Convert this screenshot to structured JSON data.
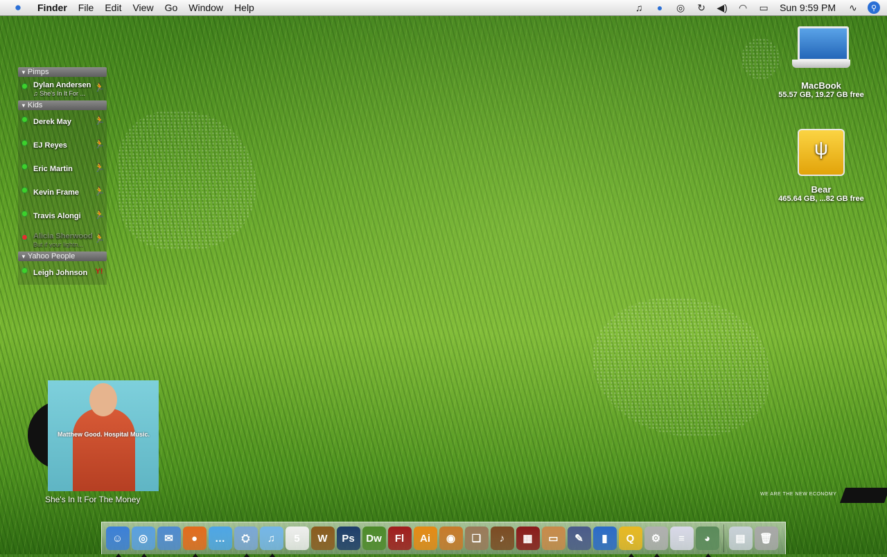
{
  "menubar": {
    "apple_icon": "apple-icon",
    "app_name": "Finder",
    "menus": [
      "File",
      "Edit",
      "View",
      "Go",
      "Window",
      "Help"
    ],
    "status_icons": [
      "music-note-icon",
      "adium-icon",
      "time-machine-icon",
      "sync-icon",
      "volume-icon",
      "wifi-icon",
      "battery-icon"
    ],
    "clock": "Sun 9:59 PM",
    "activity_icon": "activity-icon",
    "spotlight_icon": "spotlight-icon"
  },
  "buddy_list": {
    "groups": [
      {
        "name": "Pimps",
        "buddies": [
          {
            "name": "Dylan Andersen",
            "status": "♫ She's In It For ...",
            "online": true,
            "service": "aim"
          }
        ]
      },
      {
        "name": "Kids",
        "buddies": [
          {
            "name": "Derek May",
            "status": "",
            "online": true,
            "service": "aim"
          },
          {
            "name": "EJ Reyes",
            "status": "",
            "online": true,
            "service": "aim"
          },
          {
            "name": "Eric Martin",
            "status": "",
            "online": true,
            "service": "aim"
          },
          {
            "name": "Kevin Frame",
            "status": "",
            "online": true,
            "service": "aim"
          },
          {
            "name": "Travis Alongi",
            "status": "",
            "online": true,
            "service": "aim"
          },
          {
            "name": "Alicia Sherwood",
            "status": "But if your lightn...",
            "online": false,
            "service": "aim"
          }
        ]
      },
      {
        "name": "Yahoo People",
        "buddies": [
          {
            "name": "Leigh Johnson",
            "status": "",
            "online": true,
            "service": "yahoo"
          }
        ]
      }
    ]
  },
  "desktop": {
    "macbook": {
      "title": "MacBook",
      "sub": "55.57 GB, 19.27 GB free"
    },
    "bear": {
      "title": "Bear",
      "sub": "465.64 GB, ...82 GB free"
    }
  },
  "now_playing": {
    "cover_text": "Matthew Good. Hospital Music.",
    "track": "She's In It For The Money"
  },
  "watermark": "WE ARE THE NEW ECONOMY",
  "dock": {
    "apps": [
      {
        "name": "finder",
        "label": "☺",
        "color": "#3b7fd8",
        "running": true
      },
      {
        "name": "safari",
        "label": "◎",
        "color": "#5aa0e0",
        "running": true
      },
      {
        "name": "mail",
        "label": "✉",
        "color": "#4f8ad0",
        "running": false
      },
      {
        "name": "firefox",
        "label": "●",
        "color": "#e36b1c",
        "running": true
      },
      {
        "name": "ichat",
        "label": "…",
        "color": "#4da6e6",
        "running": false
      },
      {
        "name": "preview",
        "label": "⛭",
        "color": "#7ba7d6",
        "running": true
      },
      {
        "name": "itunes",
        "label": "♫",
        "color": "#74b6e8",
        "running": true
      },
      {
        "name": "ical",
        "label": "5",
        "color": "#eeeeee",
        "running": false
      },
      {
        "name": "warcraft",
        "label": "W",
        "color": "#8a5a1e",
        "running": false
      },
      {
        "name": "photoshop",
        "label": "Ps",
        "color": "#1d3c6a",
        "running": false
      },
      {
        "name": "dreamweaver",
        "label": "Dw",
        "color": "#4d8a2a",
        "running": false
      },
      {
        "name": "flash",
        "label": "Fl",
        "color": "#a01c1c",
        "running": false
      },
      {
        "name": "illustrator",
        "label": "Ai",
        "color": "#e58a14",
        "running": false
      },
      {
        "name": "image-capture",
        "label": "◉",
        "color": "#c87a2a",
        "running": false
      },
      {
        "name": "iphoto",
        "label": "❏",
        "color": "#9a7a5a",
        "running": false
      },
      {
        "name": "garageband",
        "label": "♪",
        "color": "#7b4a22",
        "running": false
      },
      {
        "name": "imovie",
        "label": "▦",
        "color": "#8a1a1a",
        "running": false
      },
      {
        "name": "frontrow",
        "label": "▭",
        "color": "#c88a4a",
        "running": false
      },
      {
        "name": "script-editor",
        "label": "✎",
        "color": "#4a5a8a",
        "running": false
      },
      {
        "name": "activity-monitor",
        "label": "▮",
        "color": "#2a6ac8",
        "running": false
      },
      {
        "name": "quicksilver",
        "label": "Q",
        "color": "#e8b822",
        "running": true
      },
      {
        "name": "terminal",
        "label": "⚙",
        "color": "#b0b0b0",
        "running": true
      },
      {
        "name": "textedit",
        "label": "≡",
        "color": "#d8d8e8",
        "running": false
      },
      {
        "name": "photo-booth",
        "label": "◕",
        "color": "#5a8a5a",
        "running": true
      }
    ],
    "docs": [
      {
        "name": "stack-folder",
        "label": "▤",
        "color": "#c8d0d8",
        "running": false
      },
      {
        "name": "trash",
        "label": "🗑",
        "color": "#a8a8a8",
        "running": false
      }
    ]
  }
}
